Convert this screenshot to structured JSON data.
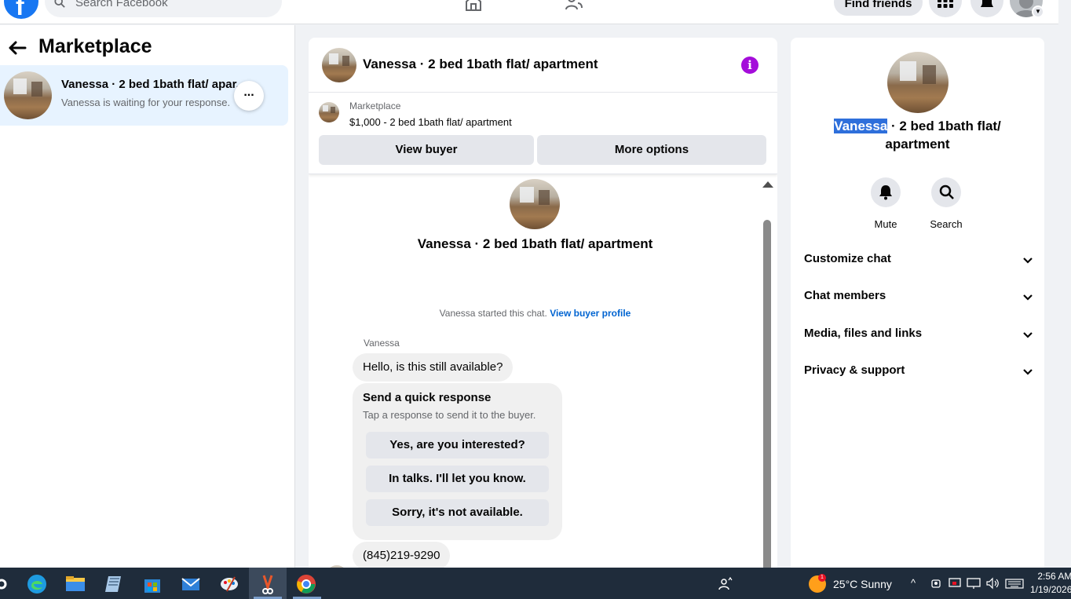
{
  "topbar": {
    "search_placeholder": "Search Facebook",
    "find_friends_label": "Find friends"
  },
  "sidebar": {
    "title": "Marketplace",
    "conversation": {
      "title": "Vanessa · 2 bed 1bath flat/ apar...",
      "subtitle": "Vanessa is waiting for your response.",
      "more_label": "..."
    }
  },
  "chat": {
    "header_title": "Vanessa · 2 bed 1bath flat/ apartment",
    "info_label": "i",
    "listing": {
      "category": "Marketplace",
      "price_title": "$1,000 - 2 bed 1bath flat/ apartment",
      "view_buyer_label": "View buyer",
      "more_options_label": "More options"
    },
    "intro_name": "Vanessa · 2 bed 1bath flat/ apartment",
    "started_text": "Vanessa started this chat.",
    "view_buyer_profile": "View buyer profile",
    "sender_name": "Vanessa",
    "messages": [
      "Hello, is this still available?",
      "(845)219-9290"
    ],
    "quick_response": {
      "title": "Send a quick response",
      "subtitle": "Tap a response to send it to the buyer.",
      "options": [
        "Yes, are you interested?",
        "In talks. I'll let you know.",
        "Sorry, it's not available."
      ]
    }
  },
  "details": {
    "name_highlight": "Vanessa",
    "name_rest": " · 2 bed 1bath flat/",
    "name_line2": "apartment",
    "actions": [
      "Mute",
      "Search"
    ],
    "sections": [
      "Customize chat",
      "Chat members",
      "Media, files and links",
      "Privacy & support"
    ]
  },
  "taskbar": {
    "weather": "25°C  Sunny",
    "weather_badge": "1",
    "time": "2:56 AM",
    "date": "1/19/2026"
  },
  "colors": {
    "fb_blue": "#1877f2",
    "link_blue": "#0064d1",
    "info_purple": "#a40dda",
    "selection_blue": "#2e6fdb",
    "taskbar": "#1f2c3b"
  }
}
